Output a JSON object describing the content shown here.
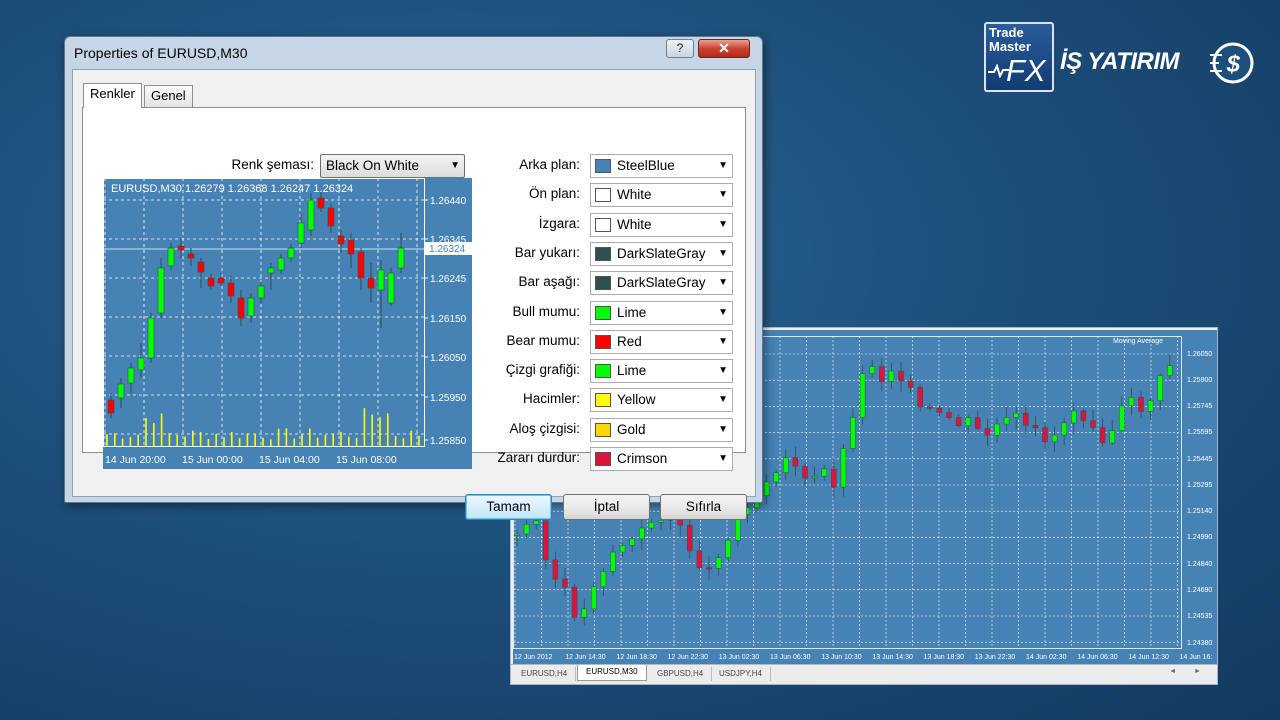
{
  "colors": {
    "steelblue": "#4682b4",
    "white": "#ffffff",
    "darkslategray": "#2f4f4f",
    "lime": "#00ff00",
    "red": "#ff0000",
    "yellow": "#ffff00",
    "gold": "#ffd700",
    "crimson": "#dc143c"
  },
  "logos": {
    "trade_master_line1": "Trade",
    "trade_master_line2": "Master",
    "trade_master_fx": "FX",
    "is_yatirim": "İŞ YATIRIM"
  },
  "dialog": {
    "title": "Properties of EURUSD,M30",
    "help_label": "?",
    "close_label": "✕",
    "tabs": [
      "Renkler",
      "Genel"
    ],
    "active_tab": "Renkler",
    "scheme": {
      "label": "Renk şeması:",
      "value": "Black On White"
    },
    "color_settings": [
      {
        "label": "Arka plan:",
        "value": "SteelBlue",
        "color": "#4682b4"
      },
      {
        "label": "Ön plan:",
        "value": "White",
        "color": "#ffffff"
      },
      {
        "label": "İzgara:",
        "value": "White",
        "color": "#ffffff"
      },
      {
        "label": "Bar yukarı:",
        "value": "DarkSlateGray",
        "color": "#2f4f4f"
      },
      {
        "label": "Bar aşağı:",
        "value": "DarkSlateGray",
        "color": "#2f4f4f"
      },
      {
        "label": "Bull mumu:",
        "value": "Lime",
        "color": "#00ff00"
      },
      {
        "label": "Bear mumu:",
        "value": "Red",
        "color": "#ff0000"
      },
      {
        "label": "Çizgi grafiği:",
        "value": "Lime",
        "color": "#00ff00"
      },
      {
        "label": "Hacimler:",
        "value": "Yellow",
        "color": "#ffff00"
      },
      {
        "label": "Aloş çizgisi:",
        "value": "Gold",
        "color": "#ffd700"
      },
      {
        "label": "Zararı durdur:",
        "value": "Crimson",
        "color": "#dc143c"
      }
    ],
    "buttons": {
      "ok": "Tamam",
      "cancel": "İptal",
      "reset": "Sıfırla"
    }
  },
  "preview_chart": {
    "header": "EURUSD,M30  1.26279 1.26368 1.26247 1.26324",
    "price_labels": [
      "1.26440",
      "1.26345",
      "1.26245",
      "1.26150",
      "1.26050",
      "1.25950",
      "1.25850"
    ],
    "current_price": "1.26324",
    "time_labels": [
      "14 Jun 20:00",
      "15 Jun 00:00",
      "15 Jun 04:00",
      "15 Jun 08:00"
    ]
  },
  "background_chart": {
    "indicator_label": "Moving Average",
    "price_labels": [
      "1.26050",
      "1.25900",
      "1.25745",
      "1.25595",
      "1.25445",
      "1.25295",
      "1.25140",
      "1.24990",
      "1.24840",
      "1.24690",
      "1.24535",
      "1.24380"
    ],
    "time_labels": [
      "12 Jun 2012",
      "12 Jun 14:30",
      "12 Jun 18:30",
      "12 Jun 22:30",
      "13 Jun 02:30",
      "13 Jun 06:30",
      "13 Jun 10:30",
      "13 Jun 14:30",
      "13 Jun 18:30",
      "13 Jun 22:30",
      "14 Jun 02:30",
      "14 Jun 06:30",
      "14 Jun 12:30",
      "14 Jun 16:"
    ],
    "tabs": [
      "EURUSD,H4",
      "EURUSD,M30",
      "GBPUSD,H4",
      "USDJPY,H4"
    ],
    "active_tab": "EURUSD,M30",
    "scroll_arrows": "◄ ►"
  }
}
